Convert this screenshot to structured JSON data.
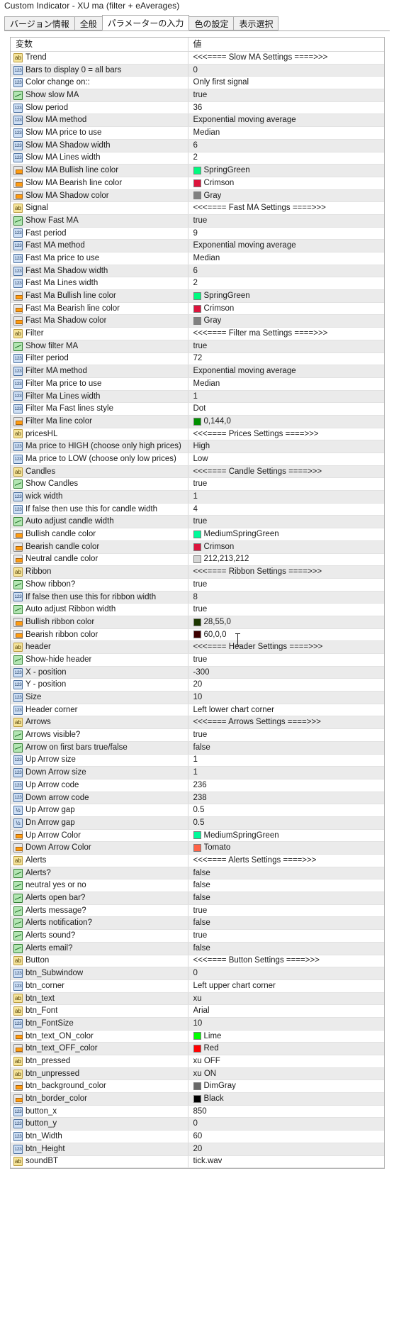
{
  "window": {
    "title": "Custom Indicator - XU ma (filter + eAverages)"
  },
  "tabs": [
    {
      "label": "バージョン情報",
      "active": false
    },
    {
      "label": "全般",
      "active": false
    },
    {
      "label": "パラメーターの入力",
      "active": true
    },
    {
      "label": "色の設定",
      "active": false
    },
    {
      "label": "表示選択",
      "active": false
    }
  ],
  "grid": {
    "headers": {
      "variable": "変数",
      "value": "値"
    },
    "rows": [
      {
        "icon": "string-param-icon",
        "name": "Trend",
        "value": "<<<==== Slow MA Settings ====>>>"
      },
      {
        "icon": "integer-param-icon",
        "name": "Bars to display 0 = all bars",
        "value": "0"
      },
      {
        "icon": "integer-param-icon",
        "name": "Color change on::",
        "value": "Only first signal"
      },
      {
        "icon": "boolean-param-icon",
        "name": "Show slow MA",
        "value": "true"
      },
      {
        "icon": "integer-param-icon",
        "name": "Slow period",
        "value": "36"
      },
      {
        "icon": "integer-param-icon",
        "name": "Slow MA method",
        "value": "Exponential moving average"
      },
      {
        "icon": "integer-param-icon",
        "name": "Slow MA price to use",
        "value": "Median"
      },
      {
        "icon": "integer-param-icon",
        "name": "Slow MA Shadow width",
        "value": "6"
      },
      {
        "icon": "integer-param-icon",
        "name": "Slow MA Lines width",
        "value": "2"
      },
      {
        "icon": "color-param-icon",
        "name": "Slow MA  Bullish line  color",
        "value": "SpringGreen",
        "swatch": "#00fa7f"
      },
      {
        "icon": "color-param-icon",
        "name": "Slow MA Bearish line  color",
        "value": "Crimson",
        "swatch": "#dc143c"
      },
      {
        "icon": "color-param-icon",
        "name": "Slow MA Shadow color",
        "value": "Gray",
        "swatch": "#808080"
      },
      {
        "icon": "string-param-icon",
        "name": "Signal",
        "value": "<<<==== Fast MA Settings ====>>>"
      },
      {
        "icon": "boolean-param-icon",
        "name": "Show Fast MA",
        "value": "true"
      },
      {
        "icon": "integer-param-icon",
        "name": "Fast period",
        "value": "9"
      },
      {
        "icon": "integer-param-icon",
        "name": "Fast MA method",
        "value": "Exponential moving average"
      },
      {
        "icon": "integer-param-icon",
        "name": "Fast Ma price to use",
        "value": "Median"
      },
      {
        "icon": "integer-param-icon",
        "name": "Fast Ma Shadow width",
        "value": "6"
      },
      {
        "icon": "integer-param-icon",
        "name": "Fast Ma Lines width",
        "value": "2"
      },
      {
        "icon": "color-param-icon",
        "name": "Fast Ma  Bullish line  color",
        "value": "SpringGreen",
        "swatch": "#00fa7f"
      },
      {
        "icon": "color-param-icon",
        "name": "Fast Ma  Bearish line  color",
        "value": "Crimson",
        "swatch": "#dc143c"
      },
      {
        "icon": "color-param-icon",
        "name": "Fast Ma Shadow color",
        "value": "Gray",
        "swatch": "#808080"
      },
      {
        "icon": "string-param-icon",
        "name": "Filter",
        "value": "<<<==== Filter ma Settings ====>>>"
      },
      {
        "icon": "boolean-param-icon",
        "name": "Show filter MA",
        "value": "true"
      },
      {
        "icon": "integer-param-icon",
        "name": "Filter period",
        "value": "72"
      },
      {
        "icon": "integer-param-icon",
        "name": "Filter MA method",
        "value": "Exponential moving average"
      },
      {
        "icon": "integer-param-icon",
        "name": "Filter Ma price to use",
        "value": "Median"
      },
      {
        "icon": "integer-param-icon",
        "name": "Filter Ma Lines width",
        "value": "1"
      },
      {
        "icon": "integer-param-icon",
        "name": "Filter Ma Fast lines style",
        "value": "Dot"
      },
      {
        "icon": "color-param-icon",
        "name": "Filter Ma  line  color",
        "value": "0,144,0",
        "swatch": "#009000"
      },
      {
        "icon": "string-param-icon",
        "name": "pricesHL",
        "value": "<<<==== Prices Settings ====>>>"
      },
      {
        "icon": "integer-param-icon",
        "name": "Ma price to HIGH (choose only high prices)",
        "value": "High"
      },
      {
        "icon": "integer-param-icon",
        "name": "Ma price to LOW (choose only low prices)",
        "value": "Low"
      },
      {
        "icon": "string-param-icon",
        "name": "Candles",
        "value": "<<<==== Candle Settings ====>>>"
      },
      {
        "icon": "boolean-param-icon",
        "name": "Show Candles",
        "value": "true"
      },
      {
        "icon": "integer-param-icon",
        "name": "wick width",
        "value": "1"
      },
      {
        "icon": "integer-param-icon",
        "name": "If  false then use this for candle width",
        "value": "4"
      },
      {
        "icon": "boolean-param-icon",
        "name": "Auto adjust candle width",
        "value": "true"
      },
      {
        "icon": "color-param-icon",
        "name": "Bullish candle  color",
        "value": "MediumSpringGreen",
        "swatch": "#00fa9a"
      },
      {
        "icon": "color-param-icon",
        "name": "Bearish candle  color",
        "value": "Crimson",
        "swatch": "#dc143c"
      },
      {
        "icon": "color-param-icon",
        "name": "Neutral candle  color",
        "value": "212,213,212",
        "swatch": "#d4d5d4"
      },
      {
        "icon": "string-param-icon",
        "name": "Ribbon",
        "value": "<<<==== Ribbon Settings ====>>>"
      },
      {
        "icon": "boolean-param-icon",
        "name": "Show ribbon?",
        "value": "true"
      },
      {
        "icon": "integer-param-icon",
        "name": "If  false then use this for ribbon width",
        "value": "8"
      },
      {
        "icon": "boolean-param-icon",
        "name": "Auto adjust Ribbon width",
        "value": "true"
      },
      {
        "icon": "color-param-icon",
        "name": "Bullish ribbon  color",
        "value": "28,55,0",
        "swatch": "#1c3700"
      },
      {
        "icon": "color-param-icon",
        "name": "Bearish ribbon  color",
        "value": "60,0,0",
        "swatch": "#3c0000"
      },
      {
        "icon": "string-param-icon",
        "name": "header",
        "value": "<<<==== Header Settings ====>>>"
      },
      {
        "icon": "boolean-param-icon",
        "name": "Show-hide header",
        "value": "true"
      },
      {
        "icon": "integer-param-icon",
        "name": "X - position",
        "value": "-300"
      },
      {
        "icon": "integer-param-icon",
        "name": "Y - position",
        "value": "20"
      },
      {
        "icon": "integer-param-icon",
        "name": "Size",
        "value": "10"
      },
      {
        "icon": "integer-param-icon",
        "name": "Header corner",
        "value": "Left lower chart corner"
      },
      {
        "icon": "string-param-icon",
        "name": "Arrows",
        "value": "<<<==== Arrows Settings ====>>>"
      },
      {
        "icon": "boolean-param-icon",
        "name": "Arrows visible?",
        "value": "true"
      },
      {
        "icon": "boolean-param-icon",
        "name": "Arrow on first bars true/false",
        "value": "false"
      },
      {
        "icon": "integer-param-icon",
        "name": "Up Arrow size",
        "value": "1"
      },
      {
        "icon": "integer-param-icon",
        "name": "Down Arrow size",
        "value": "1"
      },
      {
        "icon": "integer-param-icon",
        "name": "Up Arrow code",
        "value": "236"
      },
      {
        "icon": "integer-param-icon",
        "name": "Down arrow code",
        "value": "238"
      },
      {
        "icon": "fraction-param-icon",
        "name": "Up Arrow gap",
        "value": "0.5"
      },
      {
        "icon": "fraction-param-icon",
        "name": "Dn Arrow gap",
        "value": "0.5"
      },
      {
        "icon": "color-param-icon",
        "name": "Up Arrow Color",
        "value": "MediumSpringGreen",
        "swatch": "#00fa9a"
      },
      {
        "icon": "color-param-icon",
        "name": "Down Arrow Color",
        "value": "Tomato",
        "swatch": "#ff6347"
      },
      {
        "icon": "string-param-icon",
        "name": "Alerts",
        "value": "<<<==== Alerts Settings ====>>>"
      },
      {
        "icon": "boolean-param-icon",
        "name": "Alerts?",
        "value": "false"
      },
      {
        "icon": "boolean-param-icon",
        "name": "neutral yes or no",
        "value": "false"
      },
      {
        "icon": "boolean-param-icon",
        "name": "Alerts open bar?",
        "value": "false"
      },
      {
        "icon": "boolean-param-icon",
        "name": "Alerts message?",
        "value": "true"
      },
      {
        "icon": "boolean-param-icon",
        "name": "Alerts notification?",
        "value": "false"
      },
      {
        "icon": "boolean-param-icon",
        "name": "Alerts sound?",
        "value": "true"
      },
      {
        "icon": "boolean-param-icon",
        "name": "Alerts email?",
        "value": "false"
      },
      {
        "icon": "string-param-icon",
        "name": "Button",
        "value": "<<<==== Button Settings ====>>>"
      },
      {
        "icon": "integer-param-icon",
        "name": "btn_Subwindow",
        "value": "0"
      },
      {
        "icon": "integer-param-icon",
        "name": "btn_corner",
        "value": "Left upper chart corner"
      },
      {
        "icon": "string-param-icon",
        "name": "btn_text",
        "value": "xu"
      },
      {
        "icon": "string-param-icon",
        "name": "btn_Font",
        "value": "Arial"
      },
      {
        "icon": "integer-param-icon",
        "name": "btn_FontSize",
        "value": "10"
      },
      {
        "icon": "color-param-icon",
        "name": "btn_text_ON_color",
        "value": "Lime",
        "swatch": "#00ff00"
      },
      {
        "icon": "color-param-icon",
        "name": "btn_text_OFF_color",
        "value": "Red",
        "swatch": "#ff0000"
      },
      {
        "icon": "string-param-icon",
        "name": "btn_pressed",
        "value": "xu OFF"
      },
      {
        "icon": "string-param-icon",
        "name": "btn_unpressed",
        "value": "xu ON"
      },
      {
        "icon": "color-param-icon",
        "name": "btn_background_color",
        "value": "DimGray",
        "swatch": "#696969"
      },
      {
        "icon": "color-param-icon",
        "name": "btn_border_color",
        "value": "Black",
        "swatch": "#000000"
      },
      {
        "icon": "integer-param-icon",
        "name": "button_x",
        "value": "850"
      },
      {
        "icon": "integer-param-icon",
        "name": "button_y",
        "value": "0"
      },
      {
        "icon": "integer-param-icon",
        "name": "btn_Width",
        "value": "60"
      },
      {
        "icon": "integer-param-icon",
        "name": "btn_Height",
        "value": "20"
      },
      {
        "icon": "string-param-icon",
        "name": "soundBT",
        "value": "tick.wav"
      }
    ]
  },
  "cursor": {
    "type": "text-ibeam-cursor"
  }
}
